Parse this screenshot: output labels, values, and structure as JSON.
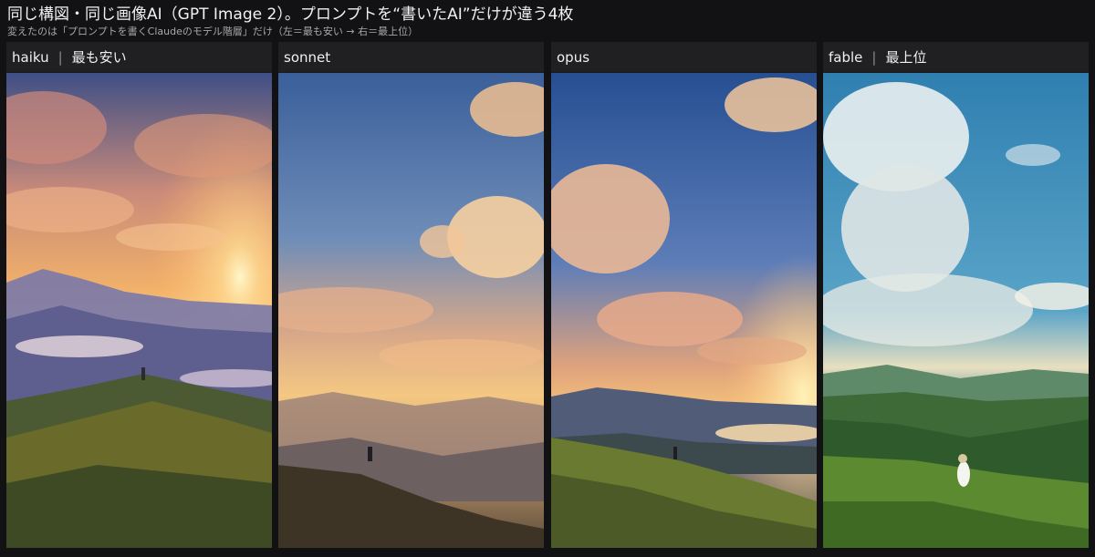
{
  "header": {
    "title": "同じ構図・同じ画像AI（GPT Image 2）。プロンプトを“書いたAI”だけが違う4枚",
    "subtitle": "変えたのは「プロンプトを書くClaudeのモデル階層」だけ（左＝最も安い → 右＝最上位）"
  },
  "panels": [
    {
      "name": "haiku",
      "tag": "最も安い",
      "image_desc": ""
    },
    {
      "name": "sonnet",
      "tag": "",
      "image_desc": ""
    },
    {
      "name": "opus",
      "tag": "",
      "image_desc": ""
    },
    {
      "name": "fable",
      "tag": "最上位",
      "image_desc": ""
    }
  ],
  "colors": {
    "background": "#121214",
    "panel_header": "#202022"
  }
}
